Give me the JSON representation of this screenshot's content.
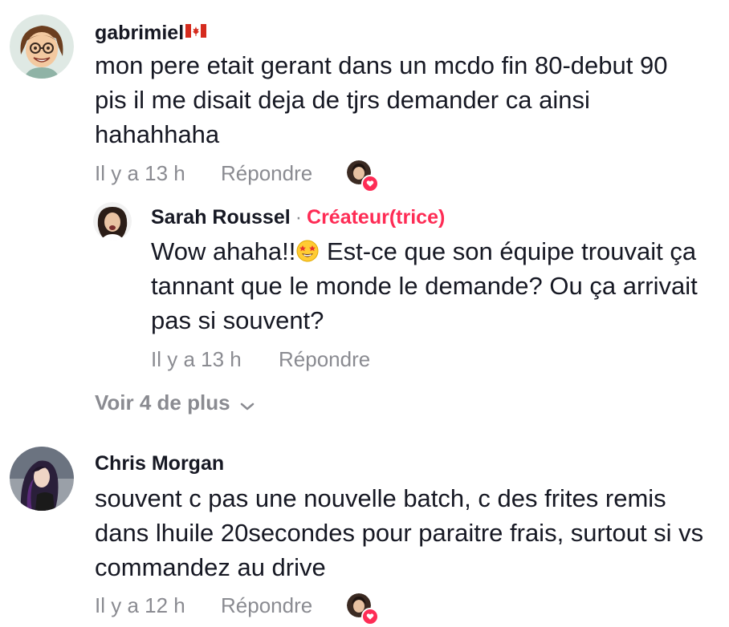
{
  "comments": [
    {
      "username": "gabrimiel",
      "flag_icon": "canada-flag-icon",
      "text": "mon pere etait gerant dans un mcdo fin 80-debut 90 pis il me disait deja de tjrs demander ca ainsi hahahhaha",
      "time": "Il y a 13 h",
      "reply_label": "Répondre",
      "liked_by_creator_icon": "creator-liked-heart-icon"
    },
    {
      "username": "Chris Morgan",
      "text": "souvent c pas une nouvelle batch, c des frites remis dans lhuile 20secondes pour paraitre frais, surtout si vs commandez au drive",
      "time": "Il y a 12 h",
      "reply_label": "Répondre",
      "liked_by_creator_icon": "creator-liked-heart-icon"
    }
  ],
  "reply": {
    "username": "Sarah Roussel",
    "separator": "·",
    "creator_label": "Créateur(trice)",
    "text_before_emoji": "Wow ahaha!!",
    "emoji": "star-struck-emoji",
    "text_after_emoji": " Est-ce que son équipe trouvait ça tannant que le monde le demande? Ou ça arrivait pas si souvent?",
    "time": "Il y a 13 h",
    "reply_label": "Répondre"
  },
  "more_replies": {
    "label": "Voir 4 de plus",
    "icon": "chevron-down-icon"
  },
  "colors": {
    "text": "#161823",
    "muted": "#8a8b91",
    "accent": "#fe2c55"
  }
}
